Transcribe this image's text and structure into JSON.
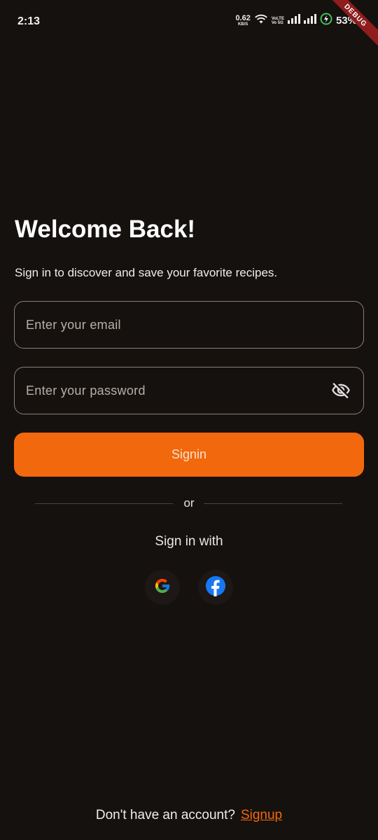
{
  "status_bar": {
    "time": "2:13",
    "net_speed_value": "0.62",
    "net_speed_unit": "KB/S",
    "volte_top": "VoLTE",
    "volte_bottom": "Vo 5G",
    "battery_percent": "53%",
    "debug_label": "DEBUG"
  },
  "login": {
    "title": "Welcome Back!",
    "subtitle": "Sign in to discover and save your favorite recipes.",
    "email_placeholder": "Enter your email",
    "email_value": "",
    "password_placeholder": "Enter your password",
    "password_value": "",
    "signin_label": "Signin",
    "divider_text": "or",
    "signin_with_label": "Sign in with",
    "footer_text": "Don't have an account?",
    "signup_label": "Signup"
  },
  "icons": {
    "password_toggle": "eye-off-icon",
    "social": [
      "google-icon",
      "facebook-icon"
    ]
  },
  "colors": {
    "background": "#15110f",
    "accent": "#f2680c",
    "field_border": "#8c7f78",
    "debug_banner": "#8f1d1d"
  }
}
